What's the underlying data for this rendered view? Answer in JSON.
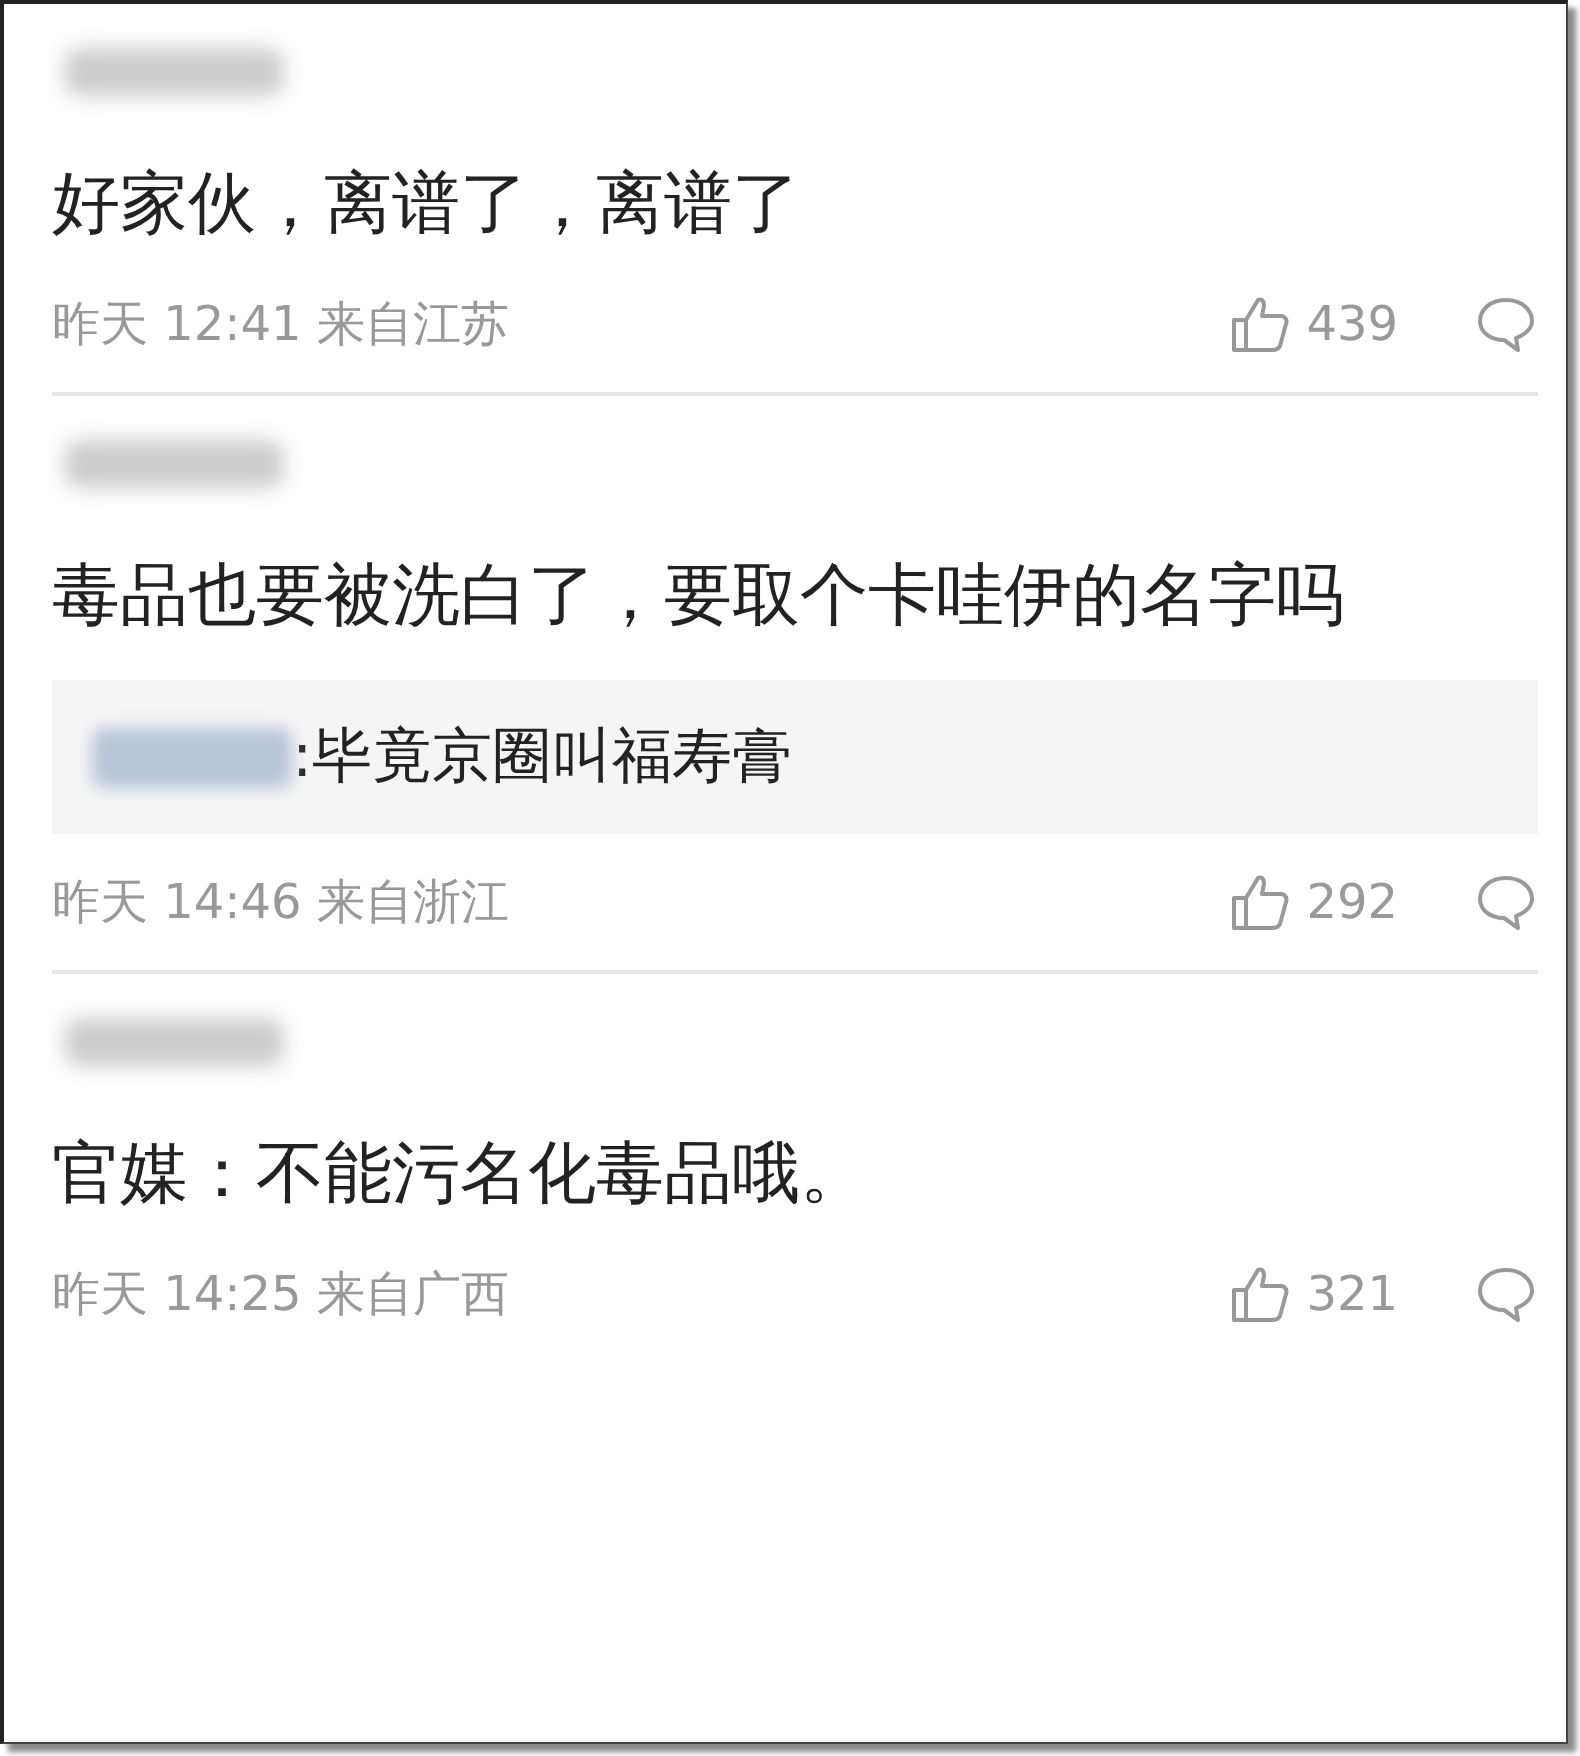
{
  "comments": [
    {
      "text": "好家伙，离谱了，离谱了",
      "time": "昨天 12:41 来自江苏",
      "likes": "439"
    },
    {
      "text": "毒品也要被洗白了，要取个卡哇伊的名字吗",
      "replies": [
        {
          "text": ":毕竟京圈叫福寿膏"
        }
      ],
      "time": "昨天 14:46 来自浙江",
      "likes": "292"
    },
    {
      "text": "官媒：不能污名化毒品哦。",
      "time": "昨天 14:25 来自广西",
      "likes": "321"
    }
  ]
}
